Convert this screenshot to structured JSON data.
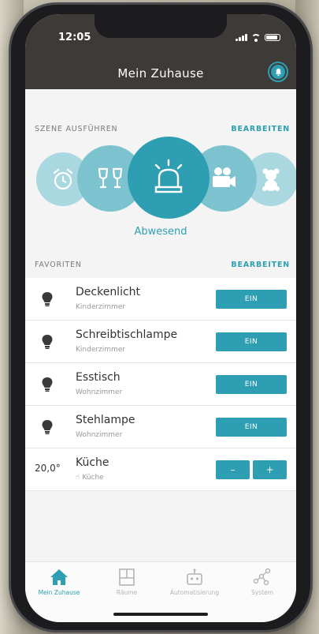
{
  "status": {
    "time": "12:05"
  },
  "header": {
    "title": "Mein Zuhause"
  },
  "scenes": {
    "section_label": "SZENE AUSFÜHREN",
    "edit_label": "BEARBEITEN",
    "active_label": "Abwesend",
    "items": [
      {
        "icon": "alarm-clock-icon"
      },
      {
        "icon": "wine-glasses-icon"
      },
      {
        "icon": "siren-icon",
        "active": true
      },
      {
        "icon": "video-camera-icon"
      },
      {
        "icon": "teddy-bear-icon"
      }
    ]
  },
  "favorites": {
    "section_label": "FAVORITEN",
    "edit_label": "BEARBEITEN",
    "items": [
      {
        "name": "Deckenlicht",
        "room": "Kinderzimmer",
        "button": "EIN",
        "icon": "bulb-icon"
      },
      {
        "name": "Schreibtischlampe",
        "room": "Kinderzimmer",
        "button": "EIN",
        "icon": "bulb-icon"
      },
      {
        "name": "Esstisch",
        "room": "Wohnzimmer",
        "button": "EIN",
        "icon": "bulb-icon"
      },
      {
        "name": "Stehlampe",
        "room": "Wohnzimmer",
        "button": "EIN",
        "icon": "bulb-icon"
      },
      {
        "name": "Küche",
        "room": "Küche",
        "temperature": "20,0°",
        "minus": "–",
        "plus": "+"
      }
    ]
  },
  "tabs": [
    {
      "label": "Mein Zuhause",
      "icon": "home-icon",
      "active": true
    },
    {
      "label": "Räume",
      "icon": "rooms-icon"
    },
    {
      "label": "Automatisierung",
      "icon": "robot-icon"
    },
    {
      "label": "System",
      "icon": "network-icon"
    }
  ],
  "colors": {
    "accent": "#2e9fb2",
    "header": "#3d3a37",
    "scene_light": "#7cc3cf"
  }
}
